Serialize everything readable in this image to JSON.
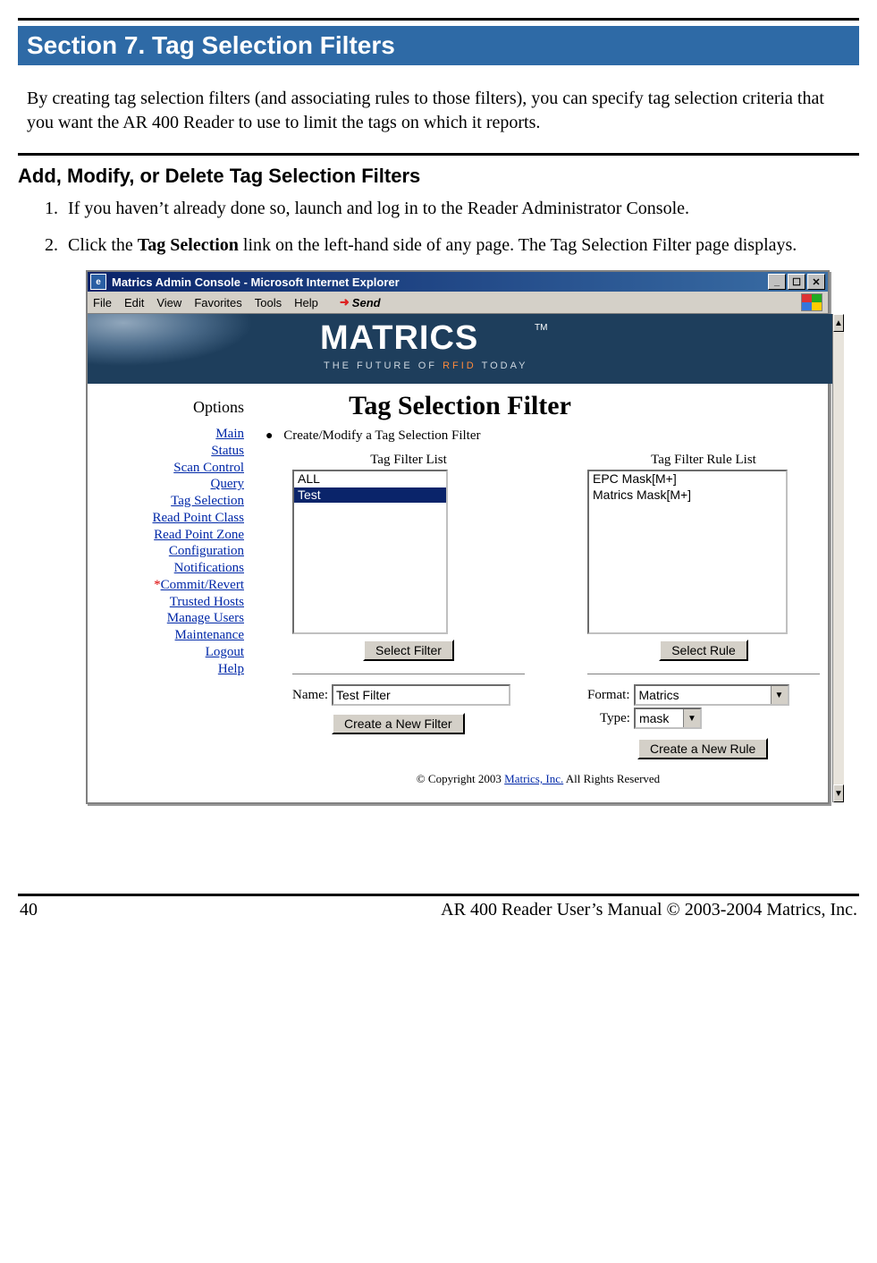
{
  "doc": {
    "section_bar": "Section 7. Tag Selection Filters",
    "intro": "By creating tag selection filters (and associating rules to those filters), you can specify tag selection criteria that you want the AR 400 Reader to use to limit the tags on which it reports.",
    "subhead": "Add, Modify, or Delete Tag Selection Filters",
    "steps": {
      "s1": "If you haven’t already done so, launch and log in to the Reader Administrator Console.",
      "s2a": "Click the ",
      "s2_bold": "Tag Selection",
      "s2b": " link on the left-hand side of any page. The Tag Selection Filter page displays."
    },
    "footer": {
      "page_num": "40",
      "right": "AR 400 Reader User’s Manual © 2003-2004 Matrics, Inc."
    }
  },
  "window": {
    "title": "Matrics Admin Console - Microsoft Internet Explorer",
    "menus": {
      "file": "File",
      "edit": "Edit",
      "view": "View",
      "favorites": "Favorites",
      "tools": "Tools",
      "help": "Help",
      "send": "Send"
    },
    "banner": {
      "brand": "MATRICS",
      "tm": "TM",
      "tag_pre": "THE FUTURE OF ",
      "tag_hl": "RFID",
      "tag_post": " TODAY"
    },
    "page_title": "Tag Selection Filter",
    "options_head": "Options",
    "nav": {
      "main": "Main",
      "status": "Status",
      "scan": "Scan Control",
      "query": "Query",
      "tagsel": "Tag Selection",
      "rpc": "Read Point Class",
      "rpz": "Read Point Zone",
      "config": "Configuration",
      "notif": "Notifications",
      "commit": "Commit/Revert",
      "trusted": "Trusted Hosts",
      "users": "Manage Users",
      "maint": "Maintenance",
      "logout": "Logout",
      "help": "Help"
    },
    "bullet": "Create/Modify a Tag Selection Filter",
    "filter": {
      "list_label": "Tag Filter List",
      "items": {
        "i0": "ALL",
        "i1": "Test"
      },
      "select_btn": "Select Filter",
      "name_label": "Name:",
      "name_value": "Test Filter",
      "create_btn": "Create a New Filter"
    },
    "rule": {
      "list_label": "Tag Filter Rule List",
      "items": {
        "i0": "EPC Mask[M+]",
        "i1": "Matrics Mask[M+]"
      },
      "select_btn": "Select Rule",
      "format_label": "Format:",
      "format_value": "Matrics",
      "type_label": "Type:",
      "type_value": "mask",
      "create_btn": "Create a New Rule"
    },
    "copyright": {
      "pre": "© Copyright 2003 ",
      "link": "Matrics, Inc.",
      "post": "  All Rights Reserved"
    }
  }
}
